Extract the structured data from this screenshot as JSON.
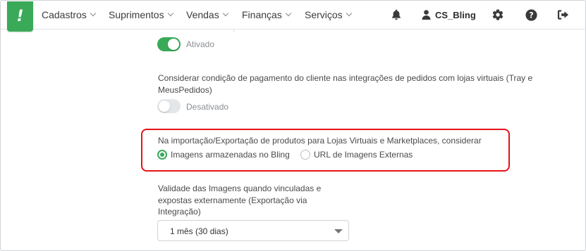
{
  "app": {
    "logo_text": "!"
  },
  "nav": {
    "items": [
      {
        "label": "Cadastros"
      },
      {
        "label": "Suprimentos"
      },
      {
        "label": "Vendas"
      },
      {
        "label": "Finanças"
      },
      {
        "label": "Serviços"
      }
    ],
    "user_name": "CS_Bling"
  },
  "icons": [
    "bell-icon",
    "user-icon",
    "gear-icon",
    "help-icon",
    "logout-icon"
  ],
  "colors": {
    "accent": "#3aaa59",
    "highlight": "#e5121b"
  },
  "settings": {
    "toggle1": {
      "state": "on",
      "label": "Ativado"
    },
    "payment_condition": {
      "text_line1": "Considerar condição de pagamento do cliente nas integrações de pedidos com lojas virtuais (Tray e",
      "text_line2": "MeusPedidos)",
      "toggle_state": "off",
      "toggle_label": "Desativado"
    },
    "images_source": {
      "question": "Na importação/Exportação de produtos para Lojas Virtuais e Marketplaces, considerar",
      "options": [
        {
          "label": "Imagens armazenadas no Bling",
          "selected": true
        },
        {
          "label": "URL de Imagens Externas",
          "selected": false
        }
      ]
    },
    "image_validity": {
      "label_line1": "Validade das Imagens quando vinculadas e",
      "label_line2": "expostas externamente (Exportação via",
      "label_line3": "Integração)",
      "selected": "1 mês (30 dias)"
    }
  }
}
